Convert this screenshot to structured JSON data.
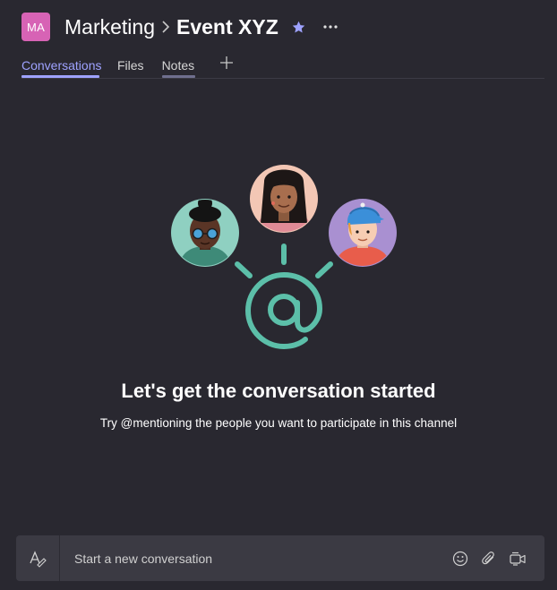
{
  "header": {
    "team_initials": "MA",
    "team_name": "Marketing",
    "channel_name": "Event XYZ",
    "favorite_icon": "star-icon",
    "more_icon": "more-options-icon"
  },
  "tabs": [
    {
      "label": "Conversations",
      "state": "active"
    },
    {
      "label": "Files",
      "state": "normal"
    },
    {
      "label": "Notes",
      "state": "hover"
    }
  ],
  "add_tab_icon": "plus-icon",
  "empty_state": {
    "title": "Let's get the conversation started",
    "subtitle": "Try @mentioning the people you want to participate in this channel"
  },
  "composer": {
    "placeholder": "Start a new conversation",
    "format_icon": "format-icon",
    "actions": [
      "emoji-icon",
      "attach-icon",
      "meet-now-icon"
    ]
  },
  "colors": {
    "background": "#292830",
    "accent": "#9ea2ff",
    "team_avatar": "#d763b5",
    "composer_bg": "#3b3a43",
    "illustration_teal": "#5cbfa9"
  }
}
